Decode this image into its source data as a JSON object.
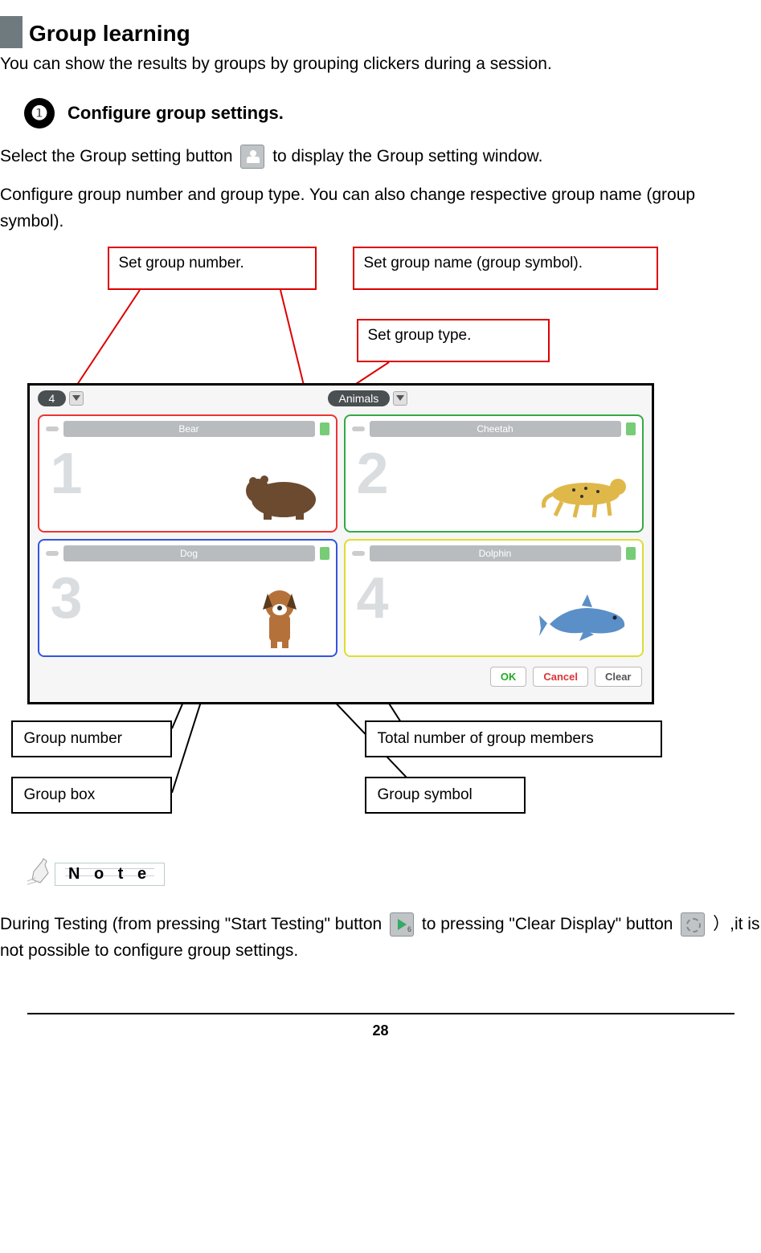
{
  "header": {
    "title": "Group learning"
  },
  "intro": "You can show the results by groups by grouping clickers during a session.",
  "step": {
    "num": "❶",
    "label": "Configure group settings."
  },
  "body": {
    "p1a": "Select the Group setting button ",
    "p1b": " to display the Group setting window.",
    "p2": "Configure group number and group type. You can also change respective group name (group symbol)."
  },
  "callouts": {
    "set_group_number": "Set group number.",
    "set_group_name": "Set group name (group symbol).",
    "set_group_type": "Set group type.",
    "group_number": "Group number",
    "group_box": "Group box",
    "total_members": "Total number of group members",
    "group_symbol": "Group symbol"
  },
  "window": {
    "group_count": "4",
    "group_type": "Animals",
    "groups": [
      {
        "num": "1",
        "name": "Bear",
        "color": "red"
      },
      {
        "num": "2",
        "name": "Cheetah",
        "color": "green"
      },
      {
        "num": "3",
        "name": "Dog",
        "color": "blue"
      },
      {
        "num": "4",
        "name": "Dolphin",
        "color": "yellow"
      }
    ],
    "buttons": {
      "ok": "OK",
      "cancel": "Cancel",
      "clear": "Clear"
    }
  },
  "note": {
    "label": "N o t e"
  },
  "note_body": {
    "a": "During Testing (from pressing \"Start Testing\" button ",
    "b": " to pressing \"Clear Display\" button ",
    "c": " ）,it is not possible to configure group settings."
  },
  "play_sub": "6",
  "page_number": "28"
}
